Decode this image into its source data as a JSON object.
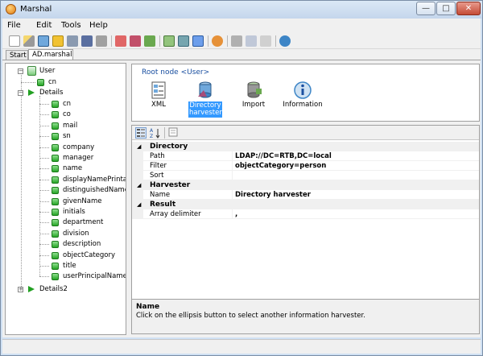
{
  "window": {
    "title": "Marshal",
    "min_glyph": "—",
    "max_glyph": "□",
    "close_glyph": "✕"
  },
  "menu": [
    "File",
    "Edit",
    "Tools",
    "Help"
  ],
  "tabs": [
    "Start",
    "AD.marshal"
  ],
  "tree": {
    "root": "User",
    "cn": "cn",
    "details": "Details",
    "details_children": [
      "cn",
      "co",
      "mail",
      "sn",
      "company",
      "manager",
      "name",
      "displayNamePrintable",
      "distinguishedName",
      "givenName",
      "initials",
      "department",
      "division",
      "description",
      "objectCategory",
      "title",
      "userPrincipalName"
    ],
    "details2": "Details2"
  },
  "root_panel": {
    "label": "Root node <User>",
    "harvesters": [
      {
        "name": "xml-icon",
        "label": "XML"
      },
      {
        "name": "directory-harvester-icon",
        "label": "Directory harvester"
      },
      {
        "name": "import-icon",
        "label": "Import"
      },
      {
        "name": "information-icon",
        "label": "Information"
      }
    ]
  },
  "property_grid": {
    "categories": [
      {
        "label": "Directory",
        "rows": [
          {
            "name": "Path",
            "value": "LDAP://DC=RTB,DC=local"
          },
          {
            "name": "Filter",
            "value": "objectCategory=person"
          },
          {
            "name": "Sort",
            "value": ""
          }
        ]
      },
      {
        "label": "Harvester",
        "rows": [
          {
            "name": "Name",
            "value": "Directory harvester"
          }
        ]
      },
      {
        "label": "Result",
        "rows": [
          {
            "name": "Array delimiter",
            "value": ","
          }
        ]
      }
    ],
    "description": {
      "title": "Name",
      "text": "Click on the ellipsis button to select another information harvester."
    }
  },
  "colors": {
    "accent": "#3399ff",
    "root_label": "#1a4fa0",
    "tree_node": "#26a526"
  }
}
